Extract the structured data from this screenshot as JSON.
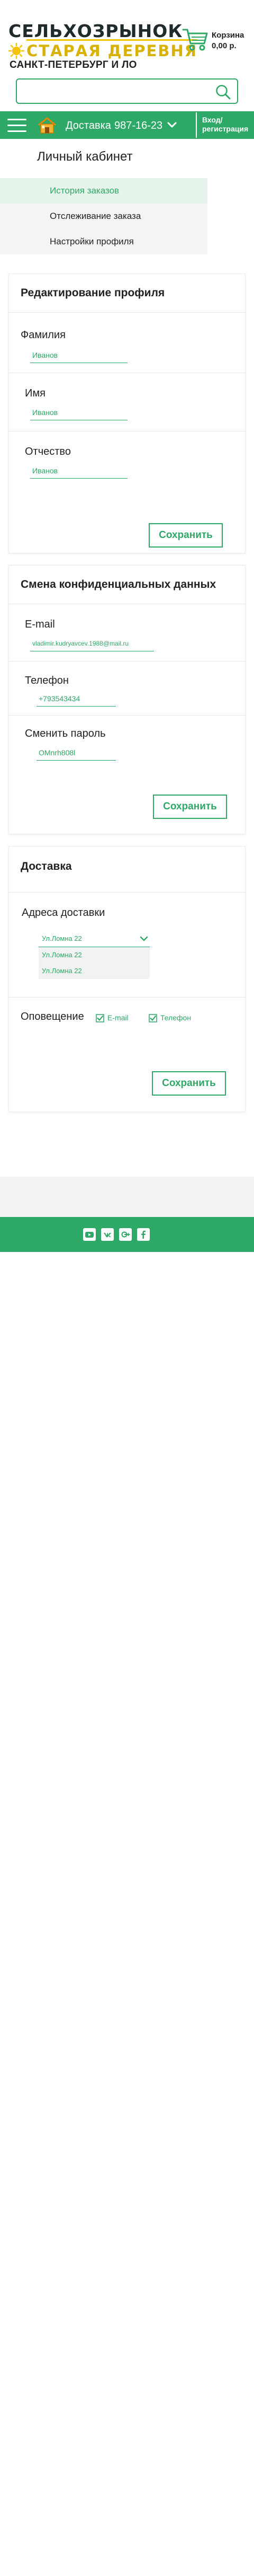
{
  "logo": {
    "line1": "СЕЛЬХОЗРЫНОК",
    "line2": "СТАРАЯ ДЕРЕВНЯ"
  },
  "header": {
    "city": "САНКТ-ПЕТЕРБУРГ И ЛО",
    "cart_title": "Корзина",
    "cart_sum": "0,00 р.",
    "search_placeholder": ""
  },
  "navbar": {
    "delivery_label": "Доставка",
    "phone": "987-16-23",
    "login_line1": "Вход/",
    "login_line2": "регистрация"
  },
  "cabinet": {
    "title": "Личный кабинет",
    "menu": [
      {
        "label": "История заказов",
        "active": true
      },
      {
        "label": "Отслеживание заказа",
        "active": false
      },
      {
        "label": "Настройки профиля",
        "active": false
      }
    ]
  },
  "profile": {
    "title": "Редактирование профиля",
    "lastname_label": "Фамилия",
    "lastname_value": "Иванов",
    "firstname_label": "Имя",
    "firstname_value": "Иванов",
    "patronymic_label": "Отчество",
    "patronymic_value": "Иванов",
    "save": "Сохранить"
  },
  "privacy": {
    "title": "Смена конфиденциальных данных",
    "email_label": "E-mail",
    "email_value": "vladimir.kudryavcev.1988@mail.ru",
    "phone_label": "Телефон",
    "phone_value": "+793543434",
    "password_label": "Сменить пароль",
    "password_value": "OMnrh808l",
    "save": "Сохранить"
  },
  "delivery": {
    "title": "Доставка",
    "address_label": "Адреса доставки",
    "address_selected": "Ул.Ломна 22",
    "address_options": [
      "Ул.Ломна 22",
      "Ул.Ломна 22"
    ],
    "notify_label": "Оповещение",
    "notify_email": "E-mail",
    "notify_phone": "Телефон",
    "save": "Сохранить"
  },
  "colors": {
    "accent": "#2ea866",
    "logo_yellow": "#d9b100",
    "menu_active_bg": "#e6f5eb"
  },
  "icons": {
    "cart": "cart-icon",
    "search": "search-icon",
    "menu": "burger-menu-icon",
    "house": "house-icon",
    "chevron": "chevron-down-icon",
    "socials": [
      "youtube-icon",
      "vk-icon",
      "google-plus-icon",
      "facebook-icon"
    ]
  }
}
